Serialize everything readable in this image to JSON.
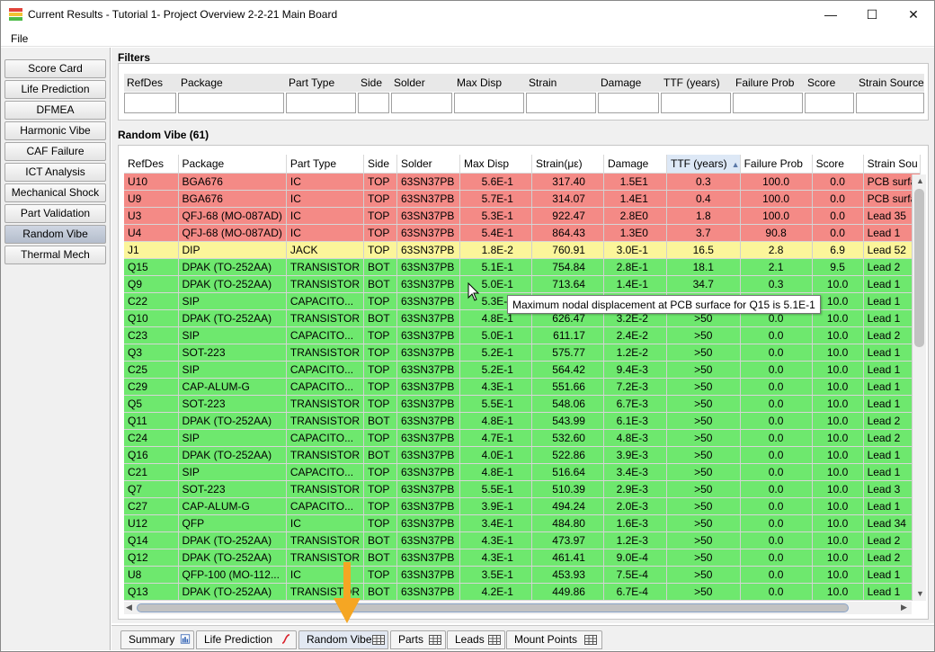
{
  "window": {
    "title": "Current Results - Tutorial 1- Project Overview 2-2-21 Main Board",
    "minimize_glyph": "—",
    "maximize_glyph": "☐",
    "close_glyph": "✕"
  },
  "menu": {
    "file": "File"
  },
  "sidebar": {
    "items": [
      {
        "label": "Score Card"
      },
      {
        "label": "Life Prediction"
      },
      {
        "label": "DFMEA"
      },
      {
        "label": "Harmonic Vibe"
      },
      {
        "label": "CAF Failure"
      },
      {
        "label": "ICT Analysis"
      },
      {
        "label": "Mechanical Shock"
      },
      {
        "label": "Part Validation"
      },
      {
        "label": "Random Vibe"
      },
      {
        "label": "Thermal Mech"
      }
    ],
    "active": "Random Vibe"
  },
  "filters": {
    "title": "Filters",
    "columns": [
      {
        "label": "RefDes",
        "value": ""
      },
      {
        "label": "Package",
        "value": ""
      },
      {
        "label": "Part Type",
        "value": ""
      },
      {
        "label": "Side",
        "value": ""
      },
      {
        "label": "Solder",
        "value": ""
      },
      {
        "label": "Max Disp",
        "value": ""
      },
      {
        "label": "Strain",
        "value": ""
      },
      {
        "label": "Damage",
        "value": ""
      },
      {
        "label": "TTF (years)",
        "value": ""
      },
      {
        "label": "Failure Prob",
        "value": ""
      },
      {
        "label": "Score",
        "value": ""
      },
      {
        "label": "Strain Source",
        "value": ""
      }
    ]
  },
  "table": {
    "title": "Random Vibe (61)",
    "headers": [
      "RefDes",
      "Package",
      "Part Type",
      "Side",
      "Solder",
      "Max Disp",
      "Strain(με)",
      "Damage",
      "TTF (years)",
      "Failure Prob",
      "Score",
      "Strain Sou"
    ],
    "sort_indicator": "▲",
    "status_colors": {
      "red": "#f48a86",
      "yellow": "#fbf59a",
      "green": "#6ee86e"
    },
    "rows": [
      {
        "status": "red",
        "cells": [
          "U10",
          "BGA676",
          "IC",
          "TOP",
          "63SN37PB",
          "5.6E-1",
          "317.40",
          "1.5E1",
          "0.3",
          "100.0",
          "0.0",
          "PCB surfa"
        ]
      },
      {
        "status": "red",
        "cells": [
          "U9",
          "BGA676",
          "IC",
          "TOP",
          "63SN37PB",
          "5.7E-1",
          "314.07",
          "1.4E1",
          "0.4",
          "100.0",
          "0.0",
          "PCB surfa"
        ]
      },
      {
        "status": "red",
        "cells": [
          "U3",
          "QFJ-68 (MO-087AD)",
          "IC",
          "TOP",
          "63SN37PB",
          "5.3E-1",
          "922.47",
          "2.8E0",
          "1.8",
          "100.0",
          "0.0",
          "Lead 35"
        ]
      },
      {
        "status": "red",
        "cells": [
          "U4",
          "QFJ-68 (MO-087AD)",
          "IC",
          "TOP",
          "63SN37PB",
          "5.4E-1",
          "864.43",
          "1.3E0",
          "3.7",
          "90.8",
          "0.0",
          "Lead 1"
        ]
      },
      {
        "status": "yellow",
        "cells": [
          "J1",
          "DIP",
          "JACK",
          "TOP",
          "63SN37PB",
          "1.8E-2",
          "760.91",
          "3.0E-1",
          "16.5",
          "2.8",
          "6.9",
          "Lead 52"
        ]
      },
      {
        "status": "green",
        "cells": [
          "Q15",
          "DPAK (TO-252AA)",
          "TRANSISTOR",
          "BOT",
          "63SN37PB",
          "5.1E-1",
          "754.84",
          "2.8E-1",
          "18.1",
          "2.1",
          "9.5",
          "Lead 2"
        ]
      },
      {
        "status": "green",
        "cells": [
          "Q9",
          "DPAK (TO-252AA)",
          "TRANSISTOR",
          "BOT",
          "63SN37PB",
          "5.0E-1",
          "713.64",
          "1.4E-1",
          "34.7",
          "0.3",
          "10.0",
          "Lead 1"
        ]
      },
      {
        "status": "green",
        "cells": [
          "C22",
          "SIP",
          "CAPACITO...",
          "TOP",
          "63SN37PB",
          "5.3E-1",
          "",
          "",
          "",
          "",
          "10.0",
          "Lead 1"
        ]
      },
      {
        "status": "green",
        "cells": [
          "Q10",
          "DPAK (TO-252AA)",
          "TRANSISTOR",
          "BOT",
          "63SN37PB",
          "4.8E-1",
          "626.47",
          "3.2E-2",
          ">50",
          "0.0",
          "10.0",
          "Lead 1"
        ]
      },
      {
        "status": "green",
        "cells": [
          "C23",
          "SIP",
          "CAPACITO...",
          "TOP",
          "63SN37PB",
          "5.0E-1",
          "611.17",
          "2.4E-2",
          ">50",
          "0.0",
          "10.0",
          "Lead 2"
        ]
      },
      {
        "status": "green",
        "cells": [
          "Q3",
          "SOT-223",
          "TRANSISTOR",
          "TOP",
          "63SN37PB",
          "5.2E-1",
          "575.77",
          "1.2E-2",
          ">50",
          "0.0",
          "10.0",
          "Lead 1"
        ]
      },
      {
        "status": "green",
        "cells": [
          "C25",
          "SIP",
          "CAPACITO...",
          "TOP",
          "63SN37PB",
          "5.2E-1",
          "564.42",
          "9.4E-3",
          ">50",
          "0.0",
          "10.0",
          "Lead 1"
        ]
      },
      {
        "status": "green",
        "cells": [
          "C29",
          "CAP-ALUM-G",
          "CAPACITO...",
          "TOP",
          "63SN37PB",
          "4.3E-1",
          "551.66",
          "7.2E-3",
          ">50",
          "0.0",
          "10.0",
          "Lead 1"
        ]
      },
      {
        "status": "green",
        "cells": [
          "Q5",
          "SOT-223",
          "TRANSISTOR",
          "TOP",
          "63SN37PB",
          "5.5E-1",
          "548.06",
          "6.7E-3",
          ">50",
          "0.0",
          "10.0",
          "Lead 1"
        ]
      },
      {
        "status": "green",
        "cells": [
          "Q11",
          "DPAK (TO-252AA)",
          "TRANSISTOR",
          "BOT",
          "63SN37PB",
          "4.8E-1",
          "543.99",
          "6.1E-3",
          ">50",
          "0.0",
          "10.0",
          "Lead 2"
        ]
      },
      {
        "status": "green",
        "cells": [
          "C24",
          "SIP",
          "CAPACITO...",
          "TOP",
          "63SN37PB",
          "4.7E-1",
          "532.60",
          "4.8E-3",
          ">50",
          "0.0",
          "10.0",
          "Lead 2"
        ]
      },
      {
        "status": "green",
        "cells": [
          "Q16",
          "DPAK (TO-252AA)",
          "TRANSISTOR",
          "BOT",
          "63SN37PB",
          "4.0E-1",
          "522.86",
          "3.9E-3",
          ">50",
          "0.0",
          "10.0",
          "Lead 1"
        ]
      },
      {
        "status": "green",
        "cells": [
          "C21",
          "SIP",
          "CAPACITO...",
          "TOP",
          "63SN37PB",
          "4.8E-1",
          "516.64",
          "3.4E-3",
          ">50",
          "0.0",
          "10.0",
          "Lead 1"
        ]
      },
      {
        "status": "green",
        "cells": [
          "Q7",
          "SOT-223",
          "TRANSISTOR",
          "TOP",
          "63SN37PB",
          "5.5E-1",
          "510.39",
          "2.9E-3",
          ">50",
          "0.0",
          "10.0",
          "Lead 3"
        ]
      },
      {
        "status": "green",
        "cells": [
          "C27",
          "CAP-ALUM-G",
          "CAPACITO...",
          "TOP",
          "63SN37PB",
          "3.9E-1",
          "494.24",
          "2.0E-3",
          ">50",
          "0.0",
          "10.0",
          "Lead 1"
        ]
      },
      {
        "status": "green",
        "cells": [
          "U12",
          "QFP",
          "IC",
          "TOP",
          "63SN37PB",
          "3.4E-1",
          "484.80",
          "1.6E-3",
          ">50",
          "0.0",
          "10.0",
          "Lead 34"
        ]
      },
      {
        "status": "green",
        "cells": [
          "Q14",
          "DPAK (TO-252AA)",
          "TRANSISTOR",
          "BOT",
          "63SN37PB",
          "4.3E-1",
          "473.97",
          "1.2E-3",
          ">50",
          "0.0",
          "10.0",
          "Lead 2"
        ]
      },
      {
        "status": "green",
        "cells": [
          "Q12",
          "DPAK (TO-252AA)",
          "TRANSISTOR",
          "BOT",
          "63SN37PB",
          "4.3E-1",
          "461.41",
          "9.0E-4",
          ">50",
          "0.0",
          "10.0",
          "Lead 2"
        ]
      },
      {
        "status": "green",
        "cells": [
          "U8",
          "QFP-100 (MO-112...",
          "IC",
          "TOP",
          "63SN37PB",
          "3.5E-1",
          "453.93",
          "7.5E-4",
          ">50",
          "0.0",
          "10.0",
          "Lead 1"
        ]
      },
      {
        "status": "green",
        "cells": [
          "Q13",
          "DPAK (TO-252AA)",
          "TRANSISTOR",
          "BOT",
          "63SN37PB",
          "4.2E-1",
          "449.86",
          "6.7E-4",
          ">50",
          "0.0",
          "10.0",
          "Lead 1"
        ]
      }
    ]
  },
  "tooltip": {
    "text": "Maximum nodal displacement at PCB surface for Q15 is 5.1E-1"
  },
  "bottom_tabs": {
    "items": [
      {
        "label": "Summary",
        "icon": "summary-icon"
      },
      {
        "label": "Life Prediction",
        "icon": "curve-icon"
      },
      {
        "label": "Random Vibe",
        "icon": "grid-icon"
      },
      {
        "label": "Parts",
        "icon": "grid-icon"
      },
      {
        "label": "Leads",
        "icon": "grid-icon"
      },
      {
        "label": "Mount Points",
        "icon": "grid-icon"
      }
    ],
    "active": "Random Vibe"
  },
  "annotation": {
    "arrow_color": "#f5a623"
  }
}
